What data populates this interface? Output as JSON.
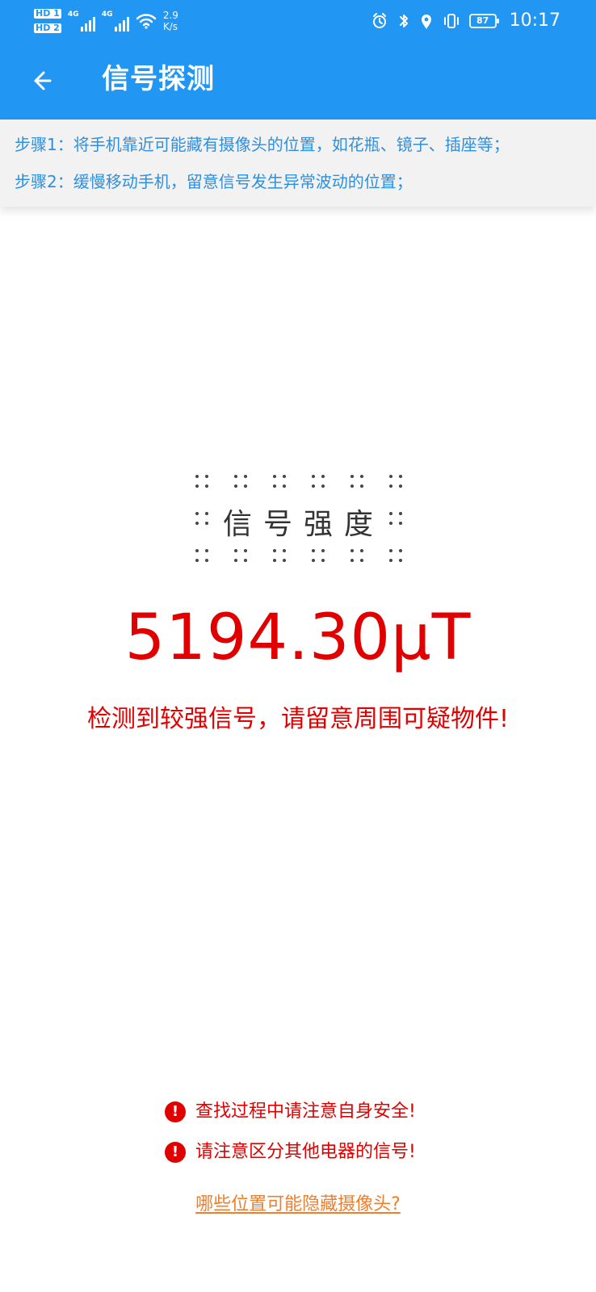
{
  "status_bar": {
    "network_speed": "2.9\nK/s",
    "battery": "87",
    "time": "10:17",
    "icons": {
      "hd1": "HD 1",
      "hd2": "HD 2",
      "signal_1": "4G",
      "signal_2": "4G",
      "wifi": "wifi-icon",
      "alarm": "alarm-icon",
      "bluetooth": "bluetooth-icon",
      "location": "location-icon",
      "vibrate": "vibrate-icon"
    }
  },
  "app_bar": {
    "title": "信号探测",
    "back_icon": "arrow-left-icon",
    "background": "#2196F3"
  },
  "instructions": {
    "step1": "步骤1：将手机靠近可能藏有摄像头的位置，如花瓶、镜子、插座等；",
    "step2": "步骤2：缓慢移动手机，留意信号发生异常波动的位置；"
  },
  "meter": {
    "label": "信号强度",
    "value": "5194.30μT",
    "message": "检测到较强信号，请留意周围可疑物件!"
  },
  "notices": [
    {
      "text": "查找过程中请注意自身安全!"
    },
    {
      "text": "请注意区分其他电器的信号!"
    }
  ],
  "help_link": {
    "text": "哪些位置可能隐藏摄像头?"
  },
  "colors": {
    "primary": "#2196F3",
    "danger": "#E00000",
    "link": "#EF7F2D",
    "instruction_text": "#2F8FDE"
  }
}
